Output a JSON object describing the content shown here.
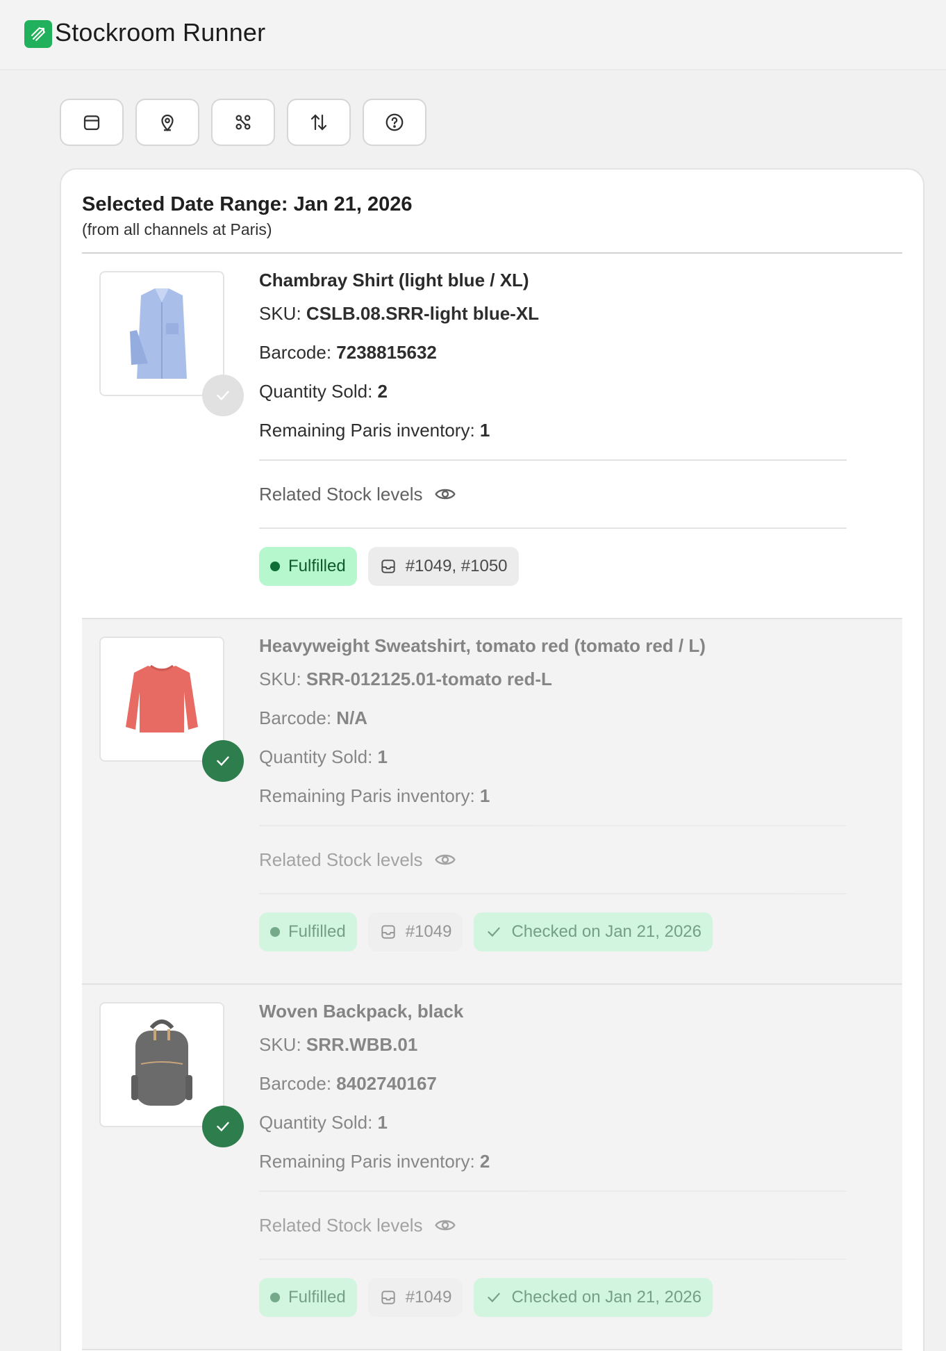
{
  "app": {
    "title": "Stockroom Runner"
  },
  "toolbar": {
    "buttons": [
      {
        "icon": "calendar-icon"
      },
      {
        "icon": "location-pin-icon"
      },
      {
        "icon": "channels-icon"
      },
      {
        "icon": "sort-arrows-icon"
      },
      {
        "icon": "help-icon"
      }
    ]
  },
  "summary": {
    "title": "Selected Date Range: Jan 21, 2026",
    "subtitle": "(from all channels at Paris)"
  },
  "labels": {
    "sku": "SKU: ",
    "barcode": "Barcode: ",
    "qty": "Quantity Sold: ",
    "remaining": "Remaining Paris inventory: ",
    "related": "Related Stock levels",
    "fulfilled": "Fulfilled"
  },
  "items": [
    {
      "name": "Chambray Shirt (light blue / XL)",
      "sku": "CSLB.08.SRR-light blue-XL",
      "barcode": "7238815632",
      "qty": "2",
      "remaining": "1",
      "orders": "#1049, #1050",
      "checked": false,
      "checked_label": ""
    },
    {
      "name": "Heavyweight Sweatshirt, tomato red (tomato red / L)",
      "sku": "SRR-012125.01-tomato red-L",
      "barcode": "N/A",
      "qty": "1",
      "remaining": "1",
      "orders": "#1049",
      "checked": true,
      "checked_label": "Checked on Jan 21, 2026"
    },
    {
      "name": "Woven Backpack, black",
      "sku": "SRR.WBB.01",
      "barcode": "8402740167",
      "qty": "1",
      "remaining": "2",
      "orders": "#1049",
      "checked": true,
      "checked_label": "Checked on Jan 21, 2026"
    }
  ],
  "colors": {
    "brand": "#21b05c",
    "check": "#2e7d4c",
    "chip_green": "#b6f7cd"
  }
}
